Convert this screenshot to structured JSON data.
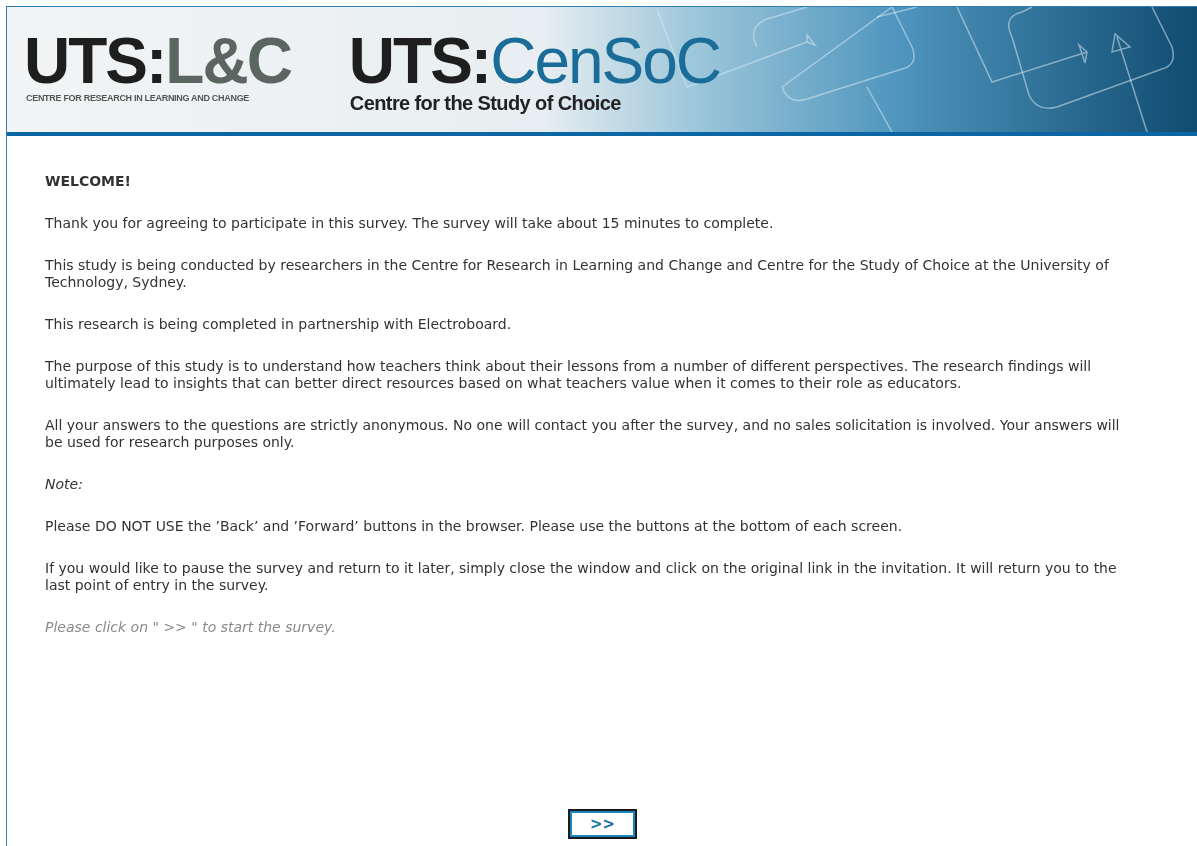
{
  "header": {
    "logos": [
      {
        "kind": "lc",
        "prefix": "UTS:",
        "name": "L&C",
        "subtitle": "CENTRE FOR RESEARCH IN LEARNING AND CHANGE"
      },
      {
        "kind": "censoc",
        "prefix": "UTS:",
        "name": "CenSoC",
        "subtitle": "Centre for the Study of Choice"
      }
    ]
  },
  "content": {
    "heading": "WELCOME!",
    "paragraphs": [
      {
        "kind": "normal",
        "text": "Thank you for agreeing to participate in this survey. The survey will take about 15 minutes to complete."
      },
      {
        "kind": "normal",
        "text": "This study is being conducted by researchers in the Centre for Research in Learning and Change and Centre for the Study of Choice at the University of Technology, Sydney."
      },
      {
        "kind": "normal",
        "text": "This research is being completed in partnership with Electroboard."
      },
      {
        "kind": "normal",
        "text": "The purpose of this study is to understand how teachers think about their lessons from a number of different perspectives. The research findings will ultimately lead to insights that can better direct resources based on what teachers value when it comes to their role as educators."
      },
      {
        "kind": "normal",
        "text": "All your answers to the questions are strictly anonymous. No one will contact you after the survey, and no sales solicitation is involved. Your answers will be used for research purposes only."
      },
      {
        "kind": "note",
        "text": "Note:"
      },
      {
        "kind": "normal",
        "text": "Please DO NOT USE the ’Back’ and ’Forward’ buttons in the browser. Please use the buttons at the bottom of each screen."
      },
      {
        "kind": "normal",
        "text": "If you would like to pause the survey and return to it later, simply close the window and click on the original link in the invitation. It will return you to the last point of entry in the survey."
      },
      {
        "kind": "hint",
        "text": "Please click on \" >> \" to start the survey."
      }
    ]
  },
  "next_button": ">>"
}
